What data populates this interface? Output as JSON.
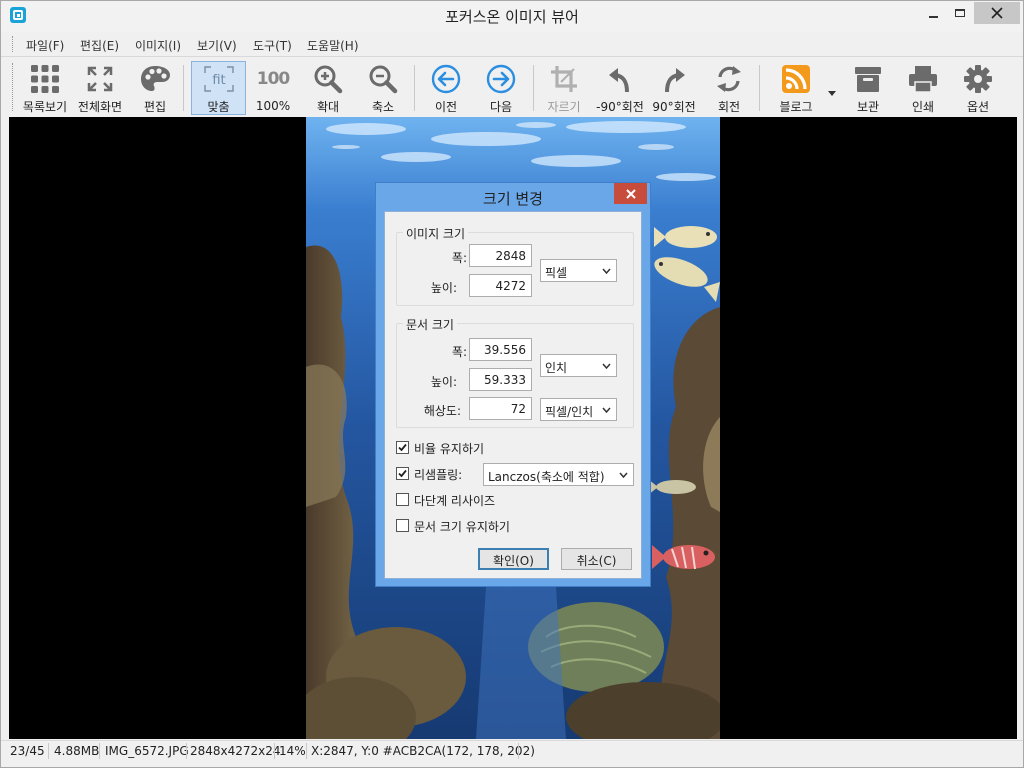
{
  "window": {
    "title": "포커스온 이미지 뷰어"
  },
  "menu": {
    "items": [
      "파일(F)",
      "편집(E)",
      "이미지(I)",
      "보기(V)",
      "도구(T)",
      "도움말(H)"
    ]
  },
  "toolbar": {
    "items": [
      {
        "label": "목록보기",
        "icon": "grid-icon"
      },
      {
        "label": "전체화면",
        "icon": "fullscreen-icon"
      },
      {
        "label": "편집",
        "icon": "palette-icon"
      },
      {
        "label": "맞춤",
        "icon": "fit-icon",
        "icon_text": "fit",
        "active": true
      },
      {
        "label": "100%",
        "icon": "actual-size-icon",
        "icon_text": "100"
      },
      {
        "label": "확대",
        "icon": "zoom-in-icon"
      },
      {
        "label": "축소",
        "icon": "zoom-out-icon"
      },
      {
        "label": "이전",
        "icon": "previous-icon"
      },
      {
        "label": "다음",
        "icon": "next-icon"
      },
      {
        "label": "자르기",
        "icon": "crop-icon",
        "disabled": true
      },
      {
        "label": "-90°회전",
        "icon": "rotate-left-icon"
      },
      {
        "label": "90°회전",
        "icon": "rotate-right-icon"
      },
      {
        "label": "회전",
        "icon": "rotate-icon"
      },
      {
        "label": "블로그",
        "icon": "rss-icon"
      },
      {
        "label": "보관",
        "icon": "archive-icon"
      },
      {
        "label": "인쇄",
        "icon": "printer-icon"
      },
      {
        "label": "옵션",
        "icon": "gear-icon"
      }
    ]
  },
  "dialog": {
    "title": "크기 변경",
    "image_size": {
      "group_title": "이미지 크기",
      "width_label": "폭:",
      "width_value": "2848",
      "height_label": "높이:",
      "height_value": "4272",
      "unit": "픽셀"
    },
    "document_size": {
      "group_title": "문서 크기",
      "width_label": "폭:",
      "width_value": "39.556",
      "height_label": "높이:",
      "height_value": "59.333",
      "unit": "인치",
      "resolution_label": "해상도:",
      "resolution_value": "72",
      "resolution_unit": "픽셀/인치"
    },
    "keep_ratio": {
      "label": "비율 유지하기",
      "checked": true
    },
    "resample": {
      "label": "리샘플링:",
      "checked": true,
      "value": "Lanczos(축소에 적합)"
    },
    "multistep": {
      "label": "다단계 리사이즈",
      "checked": false
    },
    "keep_doc_size": {
      "label": "문서 크기 유지하기",
      "checked": false
    },
    "ok_label": "확인(O)",
    "cancel_label": "취소(C)"
  },
  "status": {
    "index": "23/45",
    "filesize": "4.88MB",
    "filename": "IMG_6572.JPG",
    "dimensions": "2848x4272x24",
    "zoom": "14%",
    "pixel_info": "X:2847, Y:0 #ACB2CA(172, 178, 202)"
  },
  "colors": {
    "accent": "#1aa3d8",
    "dialog_frame": "#6aa7e8",
    "close_red": "#c74c3c",
    "nav_blue": "#2b8ee0",
    "rss_orange": "#f39a1d"
  }
}
